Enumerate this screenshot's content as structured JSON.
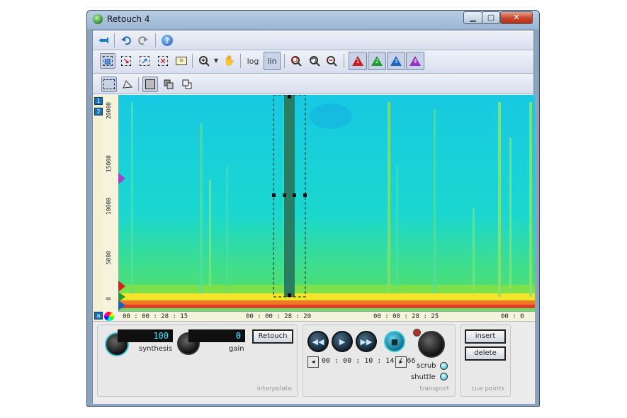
{
  "window": {
    "title": "Retouch 4",
    "controls": {
      "minimize": "▁",
      "maximize": "▢",
      "close": "✕"
    }
  },
  "toolbar1": {
    "icons": [
      "pin-icon",
      "undo-icon",
      "redo-icon",
      "help-icon"
    ],
    "help_text": "?"
  },
  "toolbar2": {
    "log_label": "log",
    "lin_label": "lin",
    "scale_selected": "lin",
    "markers": [
      {
        "num": "1",
        "color": "#c81d1d"
      },
      {
        "num": "2",
        "color": "#1e9a2e"
      },
      {
        "num": "3",
        "color": "#1c64c8"
      },
      {
        "num": "4",
        "color": "#9b2fc2"
      }
    ]
  },
  "toolbar3": {
    "icons": [
      "rect-select-icon",
      "lasso-select-icon",
      "single-layer-icon",
      "add-layer-icon",
      "subtract-layer-icon"
    ]
  },
  "spectrogram": {
    "layer_buttons": [
      "1",
      "2"
    ],
    "bottom_layer_button": "a",
    "y_ticks": [
      "0",
      "5000",
      "10000",
      "15000",
      "20000"
    ],
    "time_ticks": [
      "00 : 00 : 28 : 15",
      "00 : 00 : 28 : 20",
      "00 : 00 : 28 : 25",
      "00 : 0"
    ],
    "colors": {
      "background": "#1ad0e0",
      "hot": "#f3e21a"
    }
  },
  "interpolate": {
    "label": "interpolate",
    "synthesis_value": "100",
    "synthesis_label": "synthesis",
    "gain_value": "0",
    "gain_label": "gain",
    "retouch_button": "Retouch"
  },
  "transport": {
    "label": "transport",
    "time_display": "00 : 00 : 10 : 14 / 66",
    "scrub_label": "scrub",
    "shuttle_label": "shuttle",
    "buttons": {
      "rewind": "◀◀",
      "play": "▶",
      "forward": "▶▶",
      "stop": "■"
    },
    "frame_prev": "◀",
    "frame_next": "▶"
  },
  "cue_points": {
    "label": "cue points",
    "insert_button": "insert",
    "delete_button": "delete"
  }
}
